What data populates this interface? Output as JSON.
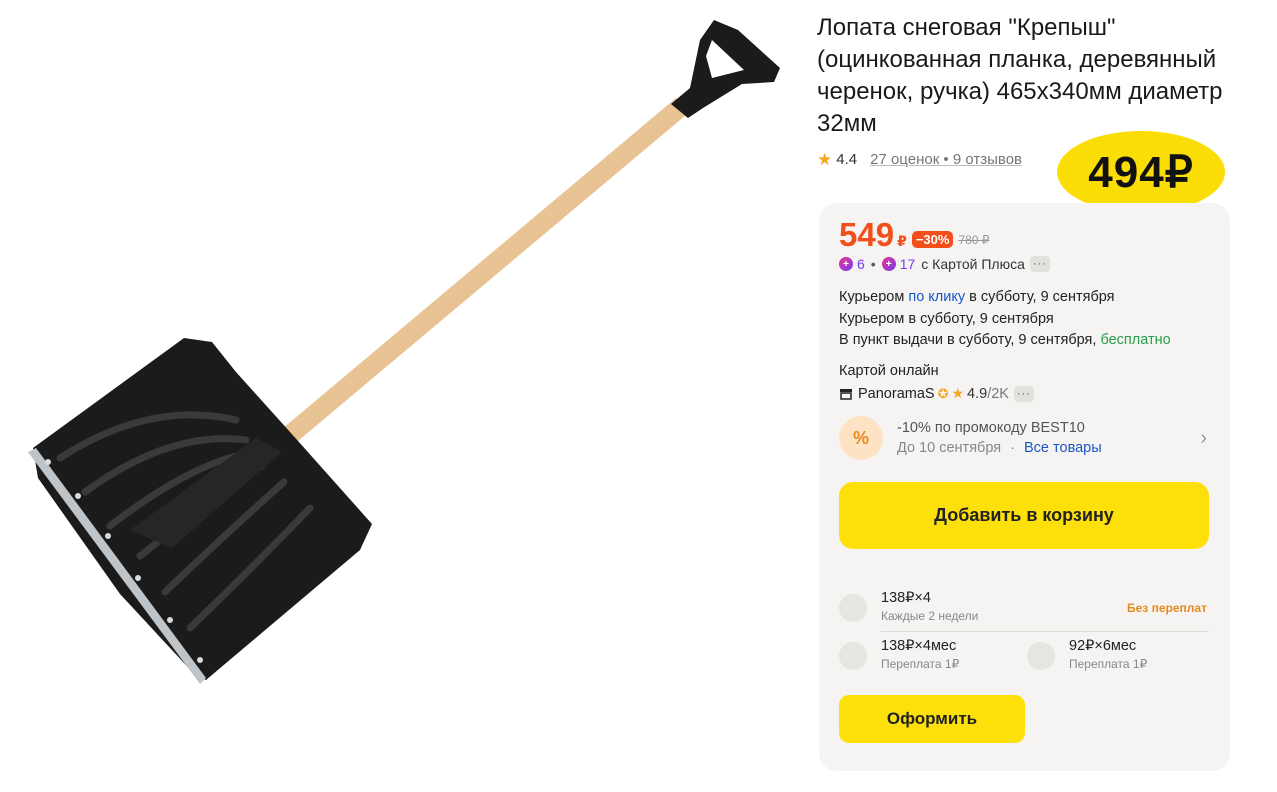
{
  "product": {
    "title": "Лопата снеговая \"Крепыш\" (оцинкованная планка, деревянный черенок, ручка) 465x340мм диаметр 32мм",
    "rating": "4.4",
    "reviews": "27 оценок • 9 отзывов",
    "image_icon": "snow-shovel-image"
  },
  "price_badge": "494₽",
  "pricing": {
    "price": "549",
    "currency": "₽",
    "discount": "−30%",
    "old_price": "780 ₽",
    "plus_points_1": "6",
    "plus_points_2": "17",
    "plus_label": "с Картой Плюса",
    "more": "···"
  },
  "delivery": {
    "line1_prefix": "Курьером ",
    "line1_link": "по клику",
    "line1_suffix": " в субботу, 9 сентября",
    "line2": "Курьером в субботу, 9 сентября",
    "line3_prefix": "В пункт выдачи в субботу, 9 сентября, ",
    "line3_free": "бесплатно"
  },
  "payment": {
    "label": "Картой онлайн"
  },
  "seller": {
    "name": "PanoramaS",
    "rating": "4.9",
    "count": "/2K",
    "more": "···"
  },
  "promo": {
    "badge": "%",
    "title": "-10% по промокоду BEST10",
    "until": "До 10 сентября",
    "separator": "·",
    "all_goods": "Все товары"
  },
  "actions": {
    "add_to_cart": "Добавить в корзину",
    "checkout": "Оформить"
  },
  "installments": [
    {
      "main": "138₽×4",
      "sub": "Каждые 2 недели"
    },
    {
      "main": "138₽×4мес",
      "sub": "Переплата 1₽"
    },
    {
      "main": "92₽×6мес",
      "sub": "Переплата 1₽"
    }
  ],
  "no_overpay": "Без переплат",
  "colors": {
    "accent_yellow": "#fde00a",
    "price_orange": "#f24f1b",
    "link_blue": "#1a56c4",
    "free_green": "#2a9d4b"
  }
}
